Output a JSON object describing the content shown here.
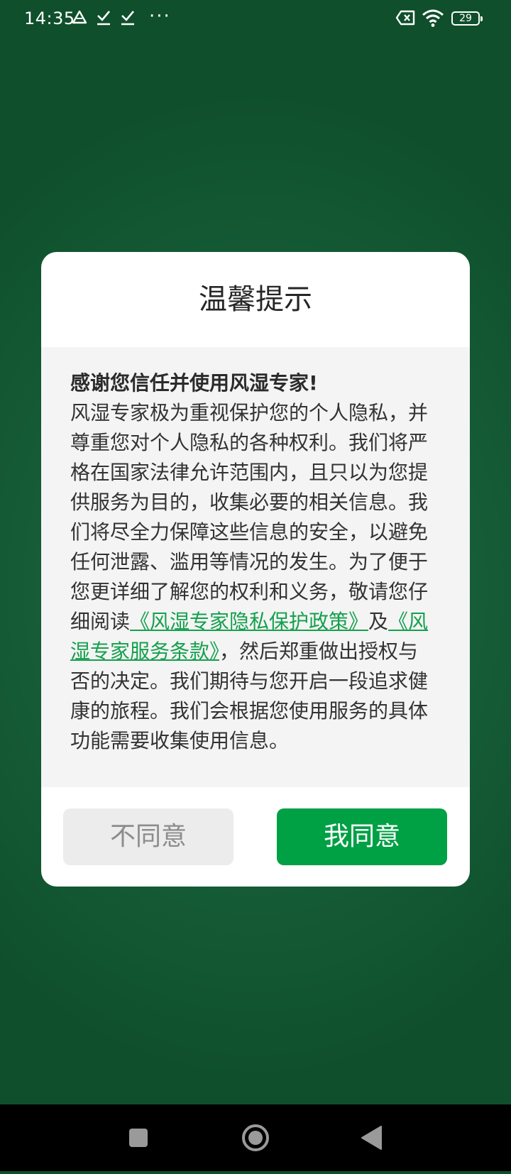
{
  "status_bar": {
    "time": "14:35",
    "dots": "···",
    "battery": "29",
    "icons": [
      "drive-icon",
      "download-done-icon",
      "download-done-icon",
      "more-dots-icon",
      "no-sim-icon",
      "wifi-icon",
      "battery-icon"
    ]
  },
  "dialog": {
    "title": "温馨提示",
    "heading": "感谢您信任并使用风湿专家!",
    "text_part1": "风湿专家极为重视保护您的个人隐私，并尊重您对个人隐私的各种权利。我们将严格在国家法律允许范围内，且只以为您提供服务为目的，收集必要的相关信息。我们将尽全力保障这些信息的安全，以避免任何泄露、滥用等情况的发生。为了便于您更详细了解您的权利和义务，敬请您仔细阅读",
    "privacy_link": "《风湿专家隐私保护政策》",
    "and": "及",
    "terms_link": "《风湿专家服务条款》",
    "text_part2": "，然后郑重做出授权与否的决定。我们期待与您开启一段追求健康的旅程。我们会根据您使用服务的具体功能需要收集使用信息。",
    "disagree_label": "不同意",
    "agree_label": "我同意"
  },
  "colors": {
    "background": "#17603a",
    "accent": "#00a045",
    "link": "#14a04c"
  },
  "nav_bar": {
    "buttons": [
      "recents-square-icon",
      "home-circle-icon",
      "back-triangle-icon"
    ]
  }
}
